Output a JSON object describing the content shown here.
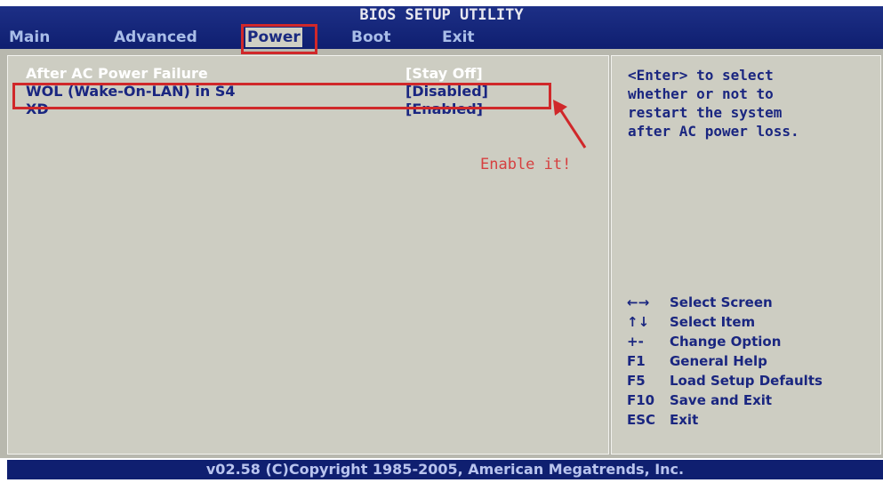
{
  "title": "BIOS SETUP UTILITY",
  "menu": [
    {
      "label": "Main"
    },
    {
      "label": "Advanced"
    },
    {
      "label": "Power"
    },
    {
      "label": "Boot"
    },
    {
      "label": "Exit"
    }
  ],
  "settings": [
    {
      "label": "After AC Power Failure",
      "value": "[Stay Off]"
    },
    {
      "label": "WOL (Wake-On-LAN) in S4",
      "value": "[Disabled]"
    },
    {
      "label": "XD",
      "value": "[Enabled]"
    }
  ],
  "help": "<Enter> to select\nwhether or not to\nrestart the system\nafter AC power loss.",
  "keys": [
    {
      "key": "←→",
      "desc": "Select Screen"
    },
    {
      "key": "↑↓",
      "desc": "Select Item"
    },
    {
      "key": "+-",
      "desc": "Change Option"
    },
    {
      "key": "F1",
      "desc": "General Help"
    },
    {
      "key": "F5",
      "desc": "Load Setup Defaults"
    },
    {
      "key": "F10",
      "desc": "Save and Exit"
    },
    {
      "key": "ESC",
      "desc": "Exit"
    }
  ],
  "footer": "v02.58 (C)Copyright 1985-2005, American Megatrends, Inc.",
  "annotation": "Enable it!",
  "colors": {
    "title_bar": "#0f1f70",
    "panel_bg": "#cdcdc2",
    "value_text": "#1a2680",
    "highlight": "#d0282a"
  }
}
